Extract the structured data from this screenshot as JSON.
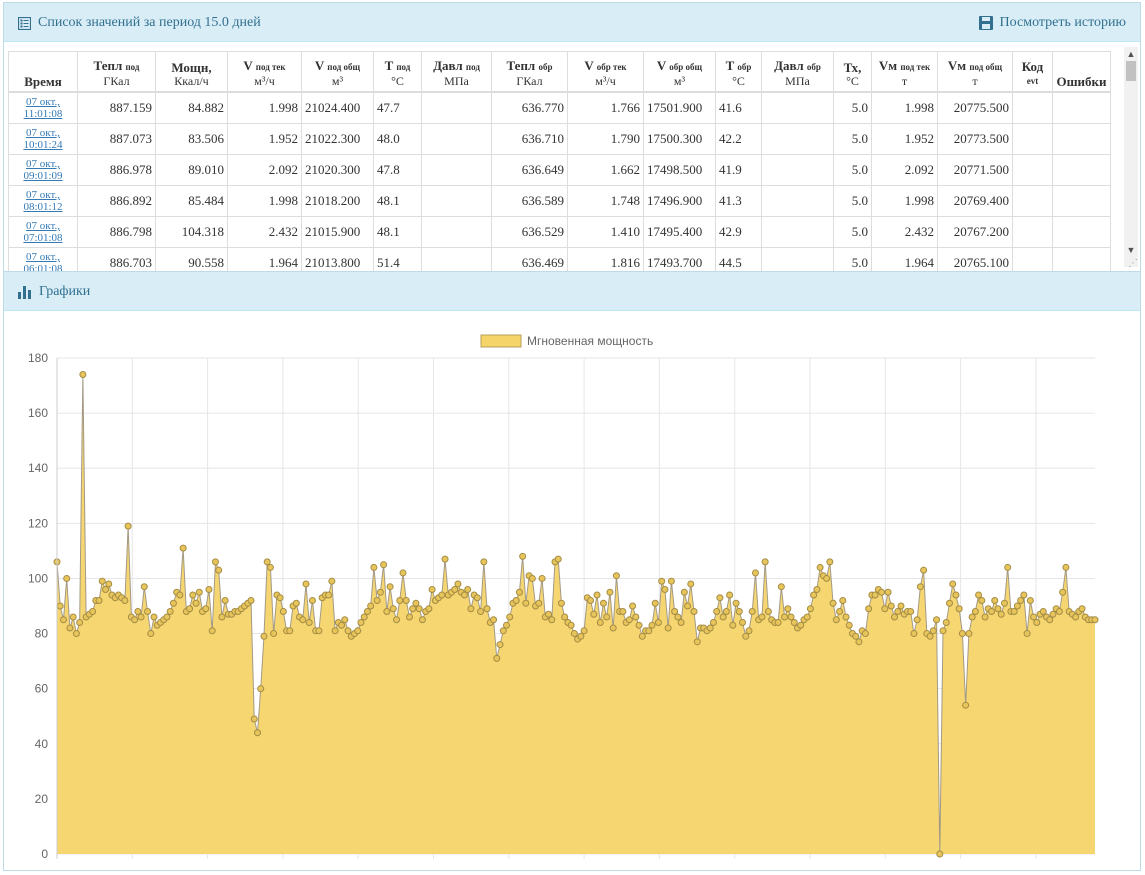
{
  "list_panel": {
    "title": "Список значений за период 15.0 дней",
    "history_link": "Посмотреть историю"
  },
  "table": {
    "columns": [
      {
        "main": "Время",
        "sub": "",
        "unit": ""
      },
      {
        "main": "Тепл",
        "sub": "под",
        "unit": "ГКал"
      },
      {
        "main": "Мощн,",
        "sub": "",
        "unit": "Ккал/ч"
      },
      {
        "main": "V",
        "sub": "под тек",
        "unit": "м³/ч"
      },
      {
        "main": "V",
        "sub": "под общ",
        "unit": "м³"
      },
      {
        "main": "T",
        "sub": "под",
        "unit": "°C"
      },
      {
        "main": "Давл",
        "sub": "под",
        "unit": "МПа"
      },
      {
        "main": "Тепл",
        "sub": "обр",
        "unit": "ГКал"
      },
      {
        "main": "V",
        "sub": "обр тек",
        "unit": "м³/ч"
      },
      {
        "main": "V",
        "sub": "обр общ",
        "unit": "м³"
      },
      {
        "main": "T",
        "sub": "обр",
        "unit": "°C"
      },
      {
        "main": "Давл",
        "sub": "обр",
        "unit": "МПа"
      },
      {
        "main": "Тх,",
        "sub": "",
        "unit": "°C"
      },
      {
        "main": "Vм",
        "sub": "под тек",
        "unit": "т"
      },
      {
        "main": "Vм",
        "sub": "под общ",
        "unit": "т"
      },
      {
        "main": "Код",
        "sub": "evt",
        "unit": ""
      },
      {
        "main": "Ошибки",
        "sub": "",
        "unit": ""
      }
    ],
    "rows": [
      {
        "date": "07 окт.,",
        "time": "11:01:08",
        "c": [
          "887.159",
          "84.882",
          "1.998",
          "21024.400",
          "47.7",
          "",
          "636.770",
          "1.766",
          "17501.900",
          "41.6",
          "",
          "5.0",
          "1.998",
          "20775.500",
          "",
          ""
        ]
      },
      {
        "date": "07 окт.,",
        "time": "10:01:24",
        "c": [
          "887.073",
          "83.506",
          "1.952",
          "21022.300",
          "48.0",
          "",
          "636.710",
          "1.790",
          "17500.300",
          "42.2",
          "",
          "5.0",
          "1.952",
          "20773.500",
          "",
          ""
        ]
      },
      {
        "date": "07 окт.,",
        "time": "09:01:09",
        "c": [
          "886.978",
          "89.010",
          "2.092",
          "21020.300",
          "47.8",
          "",
          "636.649",
          "1.662",
          "17498.500",
          "41.9",
          "",
          "5.0",
          "2.092",
          "20771.500",
          "",
          ""
        ]
      },
      {
        "date": "07 окт.,",
        "time": "08:01:12",
        "c": [
          "886.892",
          "85.484",
          "1.998",
          "21018.200",
          "48.1",
          "",
          "636.589",
          "1.748",
          "17496.900",
          "41.3",
          "",
          "5.0",
          "1.998",
          "20769.400",
          "",
          ""
        ]
      },
      {
        "date": "07 окт.,",
        "time": "07:01:08",
        "c": [
          "886.798",
          "104.318",
          "2.432",
          "21015.900",
          "48.1",
          "",
          "636.529",
          "1.410",
          "17495.400",
          "42.9",
          "",
          "5.0",
          "2.432",
          "20767.200",
          "",
          ""
        ]
      },
      {
        "date": "07 окт.,",
        "time": "06:01:08",
        "c": [
          "886.703",
          "90.558",
          "1.964",
          "21013.800",
          "51.4",
          "",
          "636.469",
          "1.816",
          "17493.700",
          "44.5",
          "",
          "5.0",
          "1.964",
          "20765.100",
          "",
          ""
        ]
      }
    ]
  },
  "graph_panel": {
    "title": "Графики"
  },
  "chart_data": {
    "type": "area",
    "series": [
      {
        "name": "Мгновенная мощность",
        "color": "#f5d469",
        "stroke": "#b8a05a"
      }
    ],
    "ylim": [
      0,
      180
    ],
    "yticks": [
      "0",
      "20",
      "40",
      "60",
      "80",
      "100",
      "120",
      "140",
      "160",
      "180"
    ],
    "grid": true,
    "legend": "top-center",
    "values": [
      106,
      90,
      85,
      100,
      82,
      86,
      80,
      84,
      174,
      86,
      87,
      88,
      92,
      92,
      99,
      96,
      98,
      94,
      93,
      94,
      93,
      92,
      119,
      86,
      85,
      88,
      86,
      97,
      88,
      80,
      86,
      83,
      84,
      85,
      86,
      88,
      91,
      95,
      94,
      111,
      88,
      89,
      94,
      91,
      95,
      88,
      89,
      96,
      81,
      106,
      103,
      86,
      92,
      87,
      87,
      88,
      88,
      89,
      90,
      91,
      92,
      49,
      44,
      60,
      79,
      106,
      104,
      80,
      94,
      93,
      88,
      81,
      81,
      90,
      91,
      86,
      85,
      98,
      84,
      92,
      81,
      81,
      93,
      94,
      94,
      99,
      81,
      84,
      83,
      85,
      81,
      79,
      80,
      81,
      84,
      86,
      88,
      90,
      104,
      92,
      95,
      105,
      88,
      97,
      89,
      85,
      92,
      102,
      92,
      86,
      89,
      91,
      89,
      85,
      88,
      89,
      96,
      92,
      93,
      94,
      107,
      94,
      95,
      96,
      98,
      95,
      94,
      96,
      89,
      94,
      93,
      88,
      106,
      89,
      84,
      85,
      71,
      76,
      81,
      83,
      86,
      91,
      92,
      95,
      108,
      91,
      101,
      100,
      90,
      91,
      100,
      86,
      87,
      85,
      106,
      107,
      91,
      86,
      84,
      83,
      80,
      78,
      79,
      81,
      93,
      92,
      87,
      94,
      84,
      91,
      86,
      95,
      82,
      101,
      88,
      88,
      84,
      85,
      90,
      86,
      83,
      79,
      81,
      81,
      83,
      91,
      84,
      99,
      96,
      82,
      99,
      88,
      86,
      84,
      95,
      90,
      98,
      88,
      77,
      82,
      82,
      81,
      82,
      84,
      88,
      93,
      86,
      88,
      94,
      83,
      91,
      88,
      84,
      79,
      81,
      88,
      102,
      85,
      86,
      106,
      88,
      85,
      84,
      84,
      97,
      86,
      89,
      86,
      84,
      82,
      83,
      85,
      86,
      89,
      94,
      96,
      104,
      101,
      100,
      106,
      91,
      85,
      88,
      92,
      86,
      83,
      80,
      79,
      77,
      81,
      80,
      89,
      94,
      94,
      96,
      95,
      89,
      95,
      90,
      86,
      88,
      90,
      87,
      88,
      88,
      80,
      85,
      97,
      103,
      80,
      79,
      81,
      85,
      0,
      81,
      84,
      91,
      98,
      94,
      89,
      80,
      54,
      80,
      86,
      88,
      94,
      92,
      86,
      89,
      88,
      92,
      89,
      87,
      91,
      104,
      88,
      88,
      90,
      92,
      94,
      80,
      92,
      86,
      84,
      87,
      88,
      86,
      85,
      87,
      89,
      88,
      95,
      104,
      88,
      87,
      86,
      88,
      89,
      86,
      85,
      85,
      85
    ]
  }
}
